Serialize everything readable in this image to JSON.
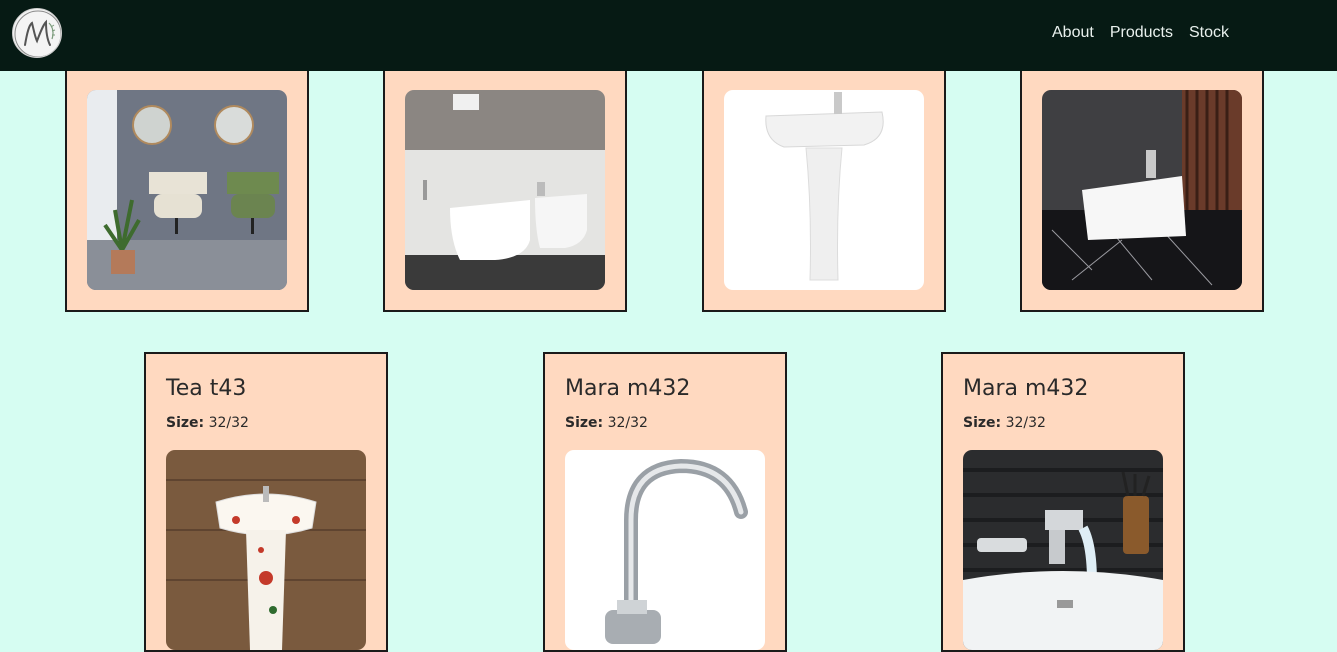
{
  "nav": {
    "logo_alt": "M",
    "links": [
      "About",
      "Products",
      "Stock"
    ]
  },
  "products_top": [
    {
      "image": "wall-mounted-basins-image"
    },
    {
      "image": "wall-hung-toilet-bidet-image"
    },
    {
      "image": "pedestal-basin-image"
    },
    {
      "image": "countertop-basin-image"
    }
  ],
  "products_bottom": [
    {
      "title": "Tea t43",
      "size_label": "Size:",
      "size_value": "32/32",
      "image": "floral-pedestal-basin-image"
    },
    {
      "title": "Mara m432",
      "size_label": "Size:",
      "size_value": "32/32",
      "image": "wall-sink-faucet-image"
    },
    {
      "title": "Mara m432",
      "size_label": "Size:",
      "size_value": "32/32",
      "image": "waterfall-basin-mixer-image"
    }
  ],
  "colors": {
    "page_background": "#d6fdf2",
    "navbar": "#061a14",
    "card_background": "#ffd9c0",
    "card_border": "#1a1a1a"
  }
}
